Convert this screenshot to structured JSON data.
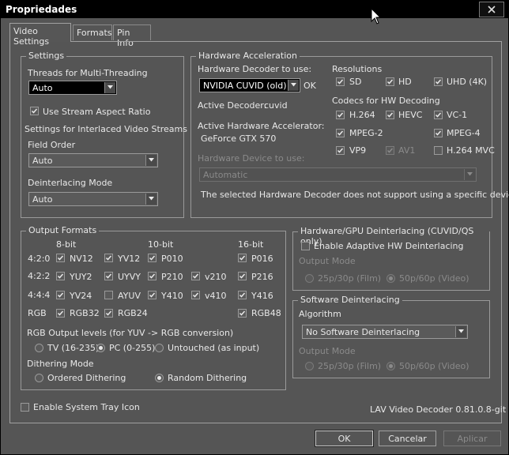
{
  "window": {
    "title": "Propriedades"
  },
  "tabs": [
    "Video Settings",
    "Formats",
    "Pin Info"
  ],
  "settings": {
    "label": "Settings",
    "threads_label": "Threads for Multi-Threading",
    "threads_value": "Auto",
    "stream_aspect_label": "Use Stream Aspect Ratio",
    "interlaced_label": "Settings for Interlaced Video Streams",
    "field_order_label": "Field Order",
    "field_order_value": "Auto",
    "deint_mode_label": "Deinterlacing Mode",
    "deint_mode_value": "Auto"
  },
  "hwaccel": {
    "label": "Hardware Acceleration",
    "decoder_label": "Hardware Decoder to use:",
    "decoder_value": "NVIDIA CUVID (old)",
    "decoder_status": "OK",
    "active_decoder_label": "Active Decoder:",
    "active_decoder_value": "cuvid",
    "active_accel_label": "Active Hardware Accelerator:",
    "active_accel_value": "GeForce GTX 570",
    "device_label": "Hardware Device to use:",
    "device_value": "Automatic",
    "device_note": "The selected Hardware Decoder does not support using a specific device.",
    "resolutions_label": "Resolutions",
    "resolutions": [
      {
        "label": "SD",
        "checked": true
      },
      {
        "label": "HD",
        "checked": true
      },
      {
        "label": "UHD (4K)",
        "checked": true
      }
    ],
    "codecs_label": "Codecs for HW Decoding",
    "codecs": [
      {
        "label": "H.264",
        "checked": true
      },
      {
        "label": "HEVC",
        "checked": true
      },
      {
        "label": "VC-1",
        "checked": true
      },
      {
        "label": "MPEG-2",
        "checked": true
      },
      {
        "label": "MPEG-4",
        "checked": true
      },
      {
        "label": "VP9",
        "checked": true
      },
      {
        "label": "AV1",
        "checked": true
      },
      {
        "label": "H.264 MVC",
        "checked": false
      }
    ]
  },
  "output": {
    "label": "Output Formats",
    "col_8bit": "8-bit",
    "col_10bit": "10-bit",
    "col_16bit": "16-bit",
    "rows": [
      "4:2:0",
      "4:2:2",
      "4:4:4",
      "RGB"
    ],
    "formats": [
      {
        "label": "NV12",
        "checked": true
      },
      {
        "label": "YV12",
        "checked": true
      },
      {
        "label": "P010",
        "checked": true
      },
      {
        "label": "P016",
        "checked": true
      },
      {
        "label": "YUY2",
        "checked": true
      },
      {
        "label": "UYVY",
        "checked": true
      },
      {
        "label": "P210",
        "checked": true
      },
      {
        "label": "v210",
        "checked": true
      },
      {
        "label": "P216",
        "checked": true
      },
      {
        "label": "YV24",
        "checked": true
      },
      {
        "label": "AYUV",
        "checked": false
      },
      {
        "label": "Y410",
        "checked": true
      },
      {
        "label": "v410",
        "checked": true
      },
      {
        "label": "Y416",
        "checked": true
      },
      {
        "label": "RGB32",
        "checked": true
      },
      {
        "label": "RGB24",
        "checked": true
      },
      {
        "label": "RGB48",
        "checked": true
      }
    ],
    "rgb_levels_label": "RGB Output levels (for YUV -> RGB conversion)",
    "rgb_levels": [
      {
        "label": "TV (16-235)",
        "selected": false
      },
      {
        "label": "PC (0-255)",
        "selected": true
      },
      {
        "label": "Untouched (as input)",
        "selected": false
      }
    ],
    "dither_label": "Dithering Mode",
    "dither": [
      {
        "label": "Ordered Dithering",
        "selected": false
      },
      {
        "label": "Random Dithering",
        "selected": true
      }
    ]
  },
  "hwdeint": {
    "label": "Hardware/GPU Deinterlacing (CUVID/QS only)",
    "enable_label": "Enable Adaptive HW Deinterlacing",
    "output_mode_label": "Output Mode",
    "mode_film": "25p/30p (Film)",
    "mode_video": "50p/60p (Video)"
  },
  "swdeint": {
    "label": "Software Deinterlacing",
    "algorithm_label": "Algorithm",
    "algorithm_value": "No Software Deinterlacing",
    "output_mode_label": "Output Mode",
    "mode_film": "25p/30p (Film)",
    "mode_video": "50p/60p (Video)"
  },
  "tray_label": "Enable System Tray Icon",
  "version": "LAV Video Decoder 0.81.0.8-git",
  "buttons": {
    "ok": "OK",
    "cancel": "Cancelar",
    "apply": "Aplicar"
  }
}
